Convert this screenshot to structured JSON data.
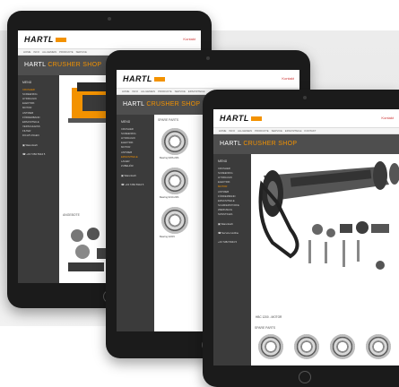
{
  "brand": {
    "logo_text": "HARTL",
    "accent": "#f39200"
  },
  "page": {
    "title_main": "HARTL",
    "title_accent": "CRUSHER SHOP"
  },
  "header": {
    "top_link": "Kontakt"
  },
  "nav": [
    "Home",
    "Info",
    "Allgemein",
    "Produkte",
    "Service",
    "Ersatzteile",
    "Kontakt"
  ],
  "sidebar": {
    "heading": "Menü",
    "items": [
      "Crusher",
      "Screening",
      "Hydraulik",
      "Elektrik",
      "Motor",
      "Antrieb",
      "Förderband",
      "Ersatzteile",
      "Verschleiß",
      "Filter",
      "Dichtungen",
      "Lager",
      "Zubehör",
      "Schmierstoffe",
      "Werkzeug",
      "Sonstiges"
    ],
    "cart_label": "Warenkorb",
    "contact_label": "Service Hotline",
    "phone": "+43 7282 5944 5"
  },
  "sections": {
    "spare_parts": "Spare Parts",
    "offers": "Angebote",
    "motor_heading": "HBC 1200 - Motor"
  },
  "parts": [
    {
      "name": "Bearing 6206-2RS",
      "price": "34,90 €"
    },
    {
      "name": "Bearing 6208-2RS",
      "price": "41,50 €"
    },
    {
      "name": "Bearing 6210-2RS",
      "price": "48,20 €"
    },
    {
      "name": "Bearing 6212-2RS",
      "price": "55,00 €"
    },
    {
      "name": "Bearing 22215",
      "price": "129,00 €"
    },
    {
      "name": "Bearing 22218",
      "price": "162,00 €"
    }
  ],
  "icons": [
    "shopping-cart-icon",
    "phone-icon",
    "home-button-icon",
    "camera-icon"
  ]
}
